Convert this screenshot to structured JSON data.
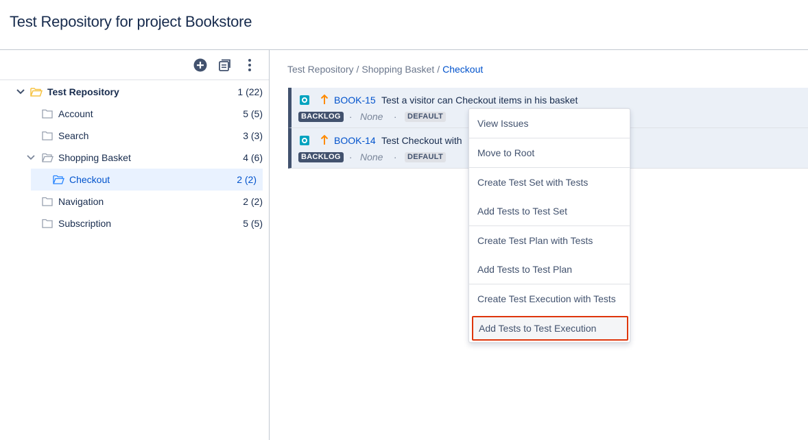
{
  "page": {
    "title": "Test Repository for project Bookstore"
  },
  "toolbar": {
    "add_icon": "plus-circle-icon",
    "doc_icon": "document-icon",
    "more_icon": "more-vertical-icon"
  },
  "tree": {
    "root": {
      "label": "Test Repository",
      "count": "1 (22)"
    },
    "items": [
      {
        "label": "Account",
        "count": "5 (5)"
      },
      {
        "label": "Search",
        "count": "3 (3)"
      },
      {
        "label": "Shopping Basket",
        "count": "4 (6)"
      },
      {
        "label": "Checkout",
        "count": "2 (2)"
      },
      {
        "label": "Navigation",
        "count": "2 (2)"
      },
      {
        "label": "Subscription",
        "count": "5 (5)"
      }
    ]
  },
  "breadcrumb": {
    "parts": [
      "Test Repository",
      "Shopping Basket"
    ],
    "separator": "/",
    "current": "Checkout"
  },
  "tests": [
    {
      "key": "BOOK-15",
      "summary": "Test a visitor can Checkout items in his basket",
      "status": "BACKLOG",
      "assignee": "None",
      "environment": "DEFAULT",
      "dot": "·"
    },
    {
      "key": "BOOK-14",
      "summary": "Test Checkout with",
      "status": "BACKLOG",
      "assignee": "None",
      "environment": "DEFAULT",
      "dot": "·"
    }
  ],
  "context_menu": {
    "items": [
      "View Issues",
      "Move to Root",
      "Create Test Set with Tests",
      "Add Tests to Test Set",
      "Create Test Plan with Tests",
      "Add Tests to Test Plan",
      "Create Test Execution with Tests",
      "Add Tests to Test Execution"
    ],
    "highlight_color": "#de350b"
  },
  "colors": {
    "link": "#0052cc",
    "text": "#172b4d",
    "folder_root": "#f6c342",
    "selected_bg": "#e9f2ff",
    "test_item_bg": "#ebf0f7",
    "priority_arrow": "#ff8b00"
  }
}
